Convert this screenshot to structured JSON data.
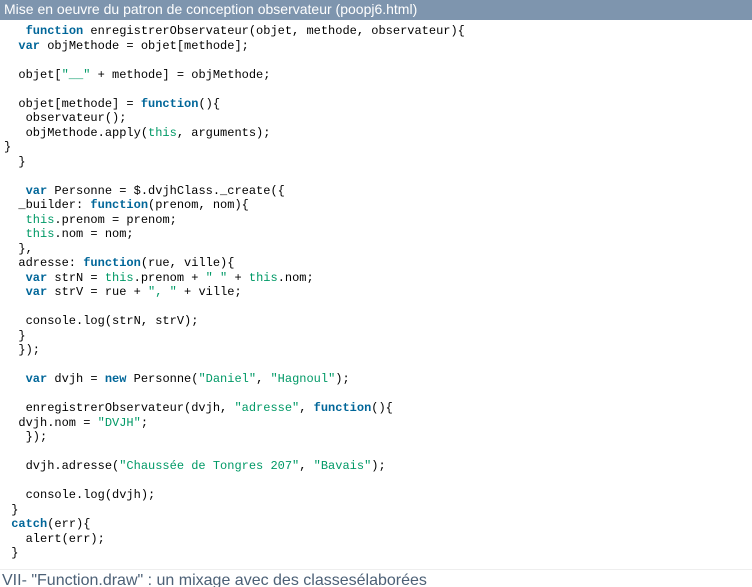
{
  "title": "Mise en oeuvre du patron de conception observateur (poopj6.html)",
  "code": {
    "l01a": "   ",
    "l01b": "function",
    "l01c": " enregistrerObservateur(objet, methode, observateur){",
    "l02a": "  ",
    "l02b": "var",
    "l02c": " objMethode = objet[methode];",
    "l03": "",
    "l04a": "  objet[",
    "l04b": "\"__\"",
    "l04c": " + methode] = objMethode;",
    "l05": "",
    "l06a": "  objet[methode] = ",
    "l06b": "function",
    "l06c": "(){",
    "l07": "   observateur();",
    "l08a": "   objMethode.apply(",
    "l08b": "this",
    "l08c": ", arguments);",
    "l09": "}",
    "l10": "  }",
    "l11": "",
    "l12a": "   ",
    "l12b": "var",
    "l12c": " Personne = $.dvjhClass._create({",
    "l13a": "  _builder: ",
    "l13b": "function",
    "l13c": "(prenom, nom){",
    "l14a": "   ",
    "l14b": "this",
    "l14c": ".prenom = prenom;",
    "l15a": "   ",
    "l15b": "this",
    "l15c": ".nom = nom;",
    "l16": "  },",
    "l17a": "  adresse: ",
    "l17b": "function",
    "l17c": "(rue, ville){",
    "l18a": "   ",
    "l18b": "var",
    "l18c": " strN = ",
    "l18d": "this",
    "l18e": ".prenom + ",
    "l18f": "\" \"",
    "l18g": " + ",
    "l18h": "this",
    "l18i": ".nom;",
    "l19a": "   ",
    "l19b": "var",
    "l19c": " strV = rue + ",
    "l19d": "\", \"",
    "l19e": " + ville;",
    "l20": "",
    "l21": "   console.log(strN, strV);",
    "l22": "  }",
    "l23": "  });",
    "l24": "",
    "l25a": "   ",
    "l25b": "var",
    "l25c": " dvjh = ",
    "l25d": "new",
    "l25e": " Personne(",
    "l25f": "\"Daniel\"",
    "l25g": ", ",
    "l25h": "\"Hagnoul\"",
    "l25i": ");",
    "l26": "",
    "l27a": "   enregistrerObservateur(dvjh, ",
    "l27b": "\"adresse\"",
    "l27c": ", ",
    "l27d": "function",
    "l27e": "(){",
    "l28a": "  dvjh.nom = ",
    "l28b": "\"DVJH\"",
    "l28c": ";",
    "l29": "   });",
    "l30": "",
    "l31a": "   dvjh.adresse(",
    "l31b": "\"Chaussée de Tongres 207\"",
    "l31c": ", ",
    "l31d": "\"Bavais\"",
    "l31e": ");",
    "l32": "",
    "l33": "   console.log(dvjh);",
    "l34": " }",
    "l35a": " ",
    "l35b": "catch",
    "l35c": "(err){",
    "l36": "   alert(err);",
    "l37": " }"
  },
  "footer": "VII- \"Function.draw\" : un mixage avec des classesélaborées"
}
